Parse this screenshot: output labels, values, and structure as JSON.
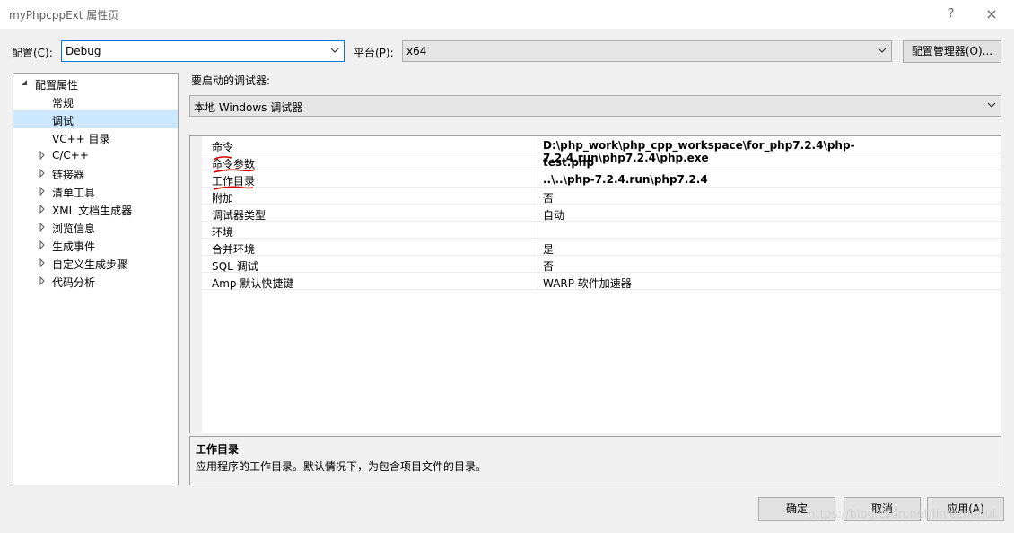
{
  "window": {
    "title": "myPhpcppExt 属性页",
    "help_glyph": "?",
    "close_glyph": "×"
  },
  "toolbar": {
    "config_label": "配置(C):",
    "config_value": "Debug",
    "platform_label": "平台(P):",
    "platform_value": "x64",
    "config_manager_label": "配置管理器(O)..."
  },
  "tree": {
    "root": "配置属性",
    "items": [
      {
        "label": "常规",
        "expandable": false,
        "selected": false
      },
      {
        "label": "调试",
        "expandable": false,
        "selected": true
      },
      {
        "label": "VC++ 目录",
        "expandable": false,
        "selected": false
      },
      {
        "label": "C/C++",
        "expandable": true,
        "selected": false
      },
      {
        "label": "链接器",
        "expandable": true,
        "selected": false
      },
      {
        "label": "清单工具",
        "expandable": true,
        "selected": false
      },
      {
        "label": "XML 文档生成器",
        "expandable": true,
        "selected": false
      },
      {
        "label": "浏览信息",
        "expandable": true,
        "selected": false
      },
      {
        "label": "生成事件",
        "expandable": true,
        "selected": false
      },
      {
        "label": "自定义生成步骤",
        "expandable": true,
        "selected": false
      },
      {
        "label": "代码分析",
        "expandable": true,
        "selected": false
      }
    ]
  },
  "debugger": {
    "label": "要启动的调试器:",
    "value": "本地 Windows 调试器"
  },
  "properties": [
    {
      "key": "命令",
      "value": "D:\\php_work\\php_cpp_workspace\\for_php7.2.4\\php-7.2.4.run\\php7.2.4\\php.exe",
      "bold": true
    },
    {
      "key": "命令参数",
      "value": "test.php",
      "bold": true
    },
    {
      "key": "工作目录",
      "value": "..\\..\\php-7.2.4.run\\php7.2.4",
      "bold": true
    },
    {
      "key": "附加",
      "value": "否",
      "bold": false
    },
    {
      "key": "调试器类型",
      "value": "自动",
      "bold": false
    },
    {
      "key": "环境",
      "value": "",
      "bold": false
    },
    {
      "key": "合并环境",
      "value": "是",
      "bold": false
    },
    {
      "key": "SQL 调试",
      "value": "否",
      "bold": false
    },
    {
      "key": "Amp 默认快捷键",
      "value": "WARP 软件加速器",
      "bold": false
    }
  ],
  "description": {
    "title": "工作目录",
    "text": "应用程序的工作目录。默认情况下，为包含项目文件的目录。"
  },
  "footer": {
    "ok": "确定",
    "cancel": "取消",
    "apply": "应用(A)"
  },
  "watermark": "https://blog.csdn.net/linlezhuhui",
  "colors": {
    "selection": "#cce8ff",
    "focus_border": "#0078d7",
    "annotation": "#d40000"
  }
}
